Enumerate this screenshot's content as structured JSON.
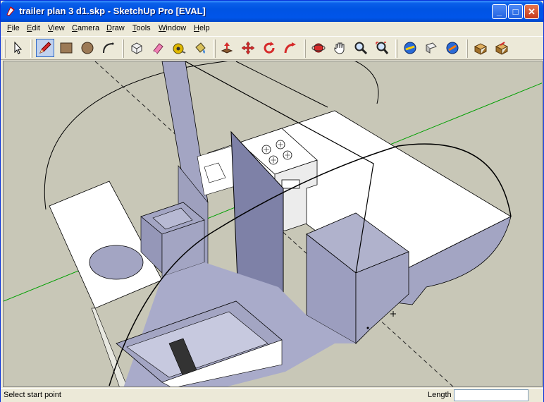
{
  "window": {
    "title": "trailer plan 3 d1.skp - SketchUp Pro [EVAL]",
    "minimize_glyph": "_",
    "maximize_glyph": "□",
    "close_glyph": "✕"
  },
  "menu": {
    "items": [
      {
        "first": "F",
        "rest": "ile"
      },
      {
        "first": "E",
        "rest": "dit"
      },
      {
        "first": "V",
        "rest": "iew"
      },
      {
        "first": "C",
        "rest": "amera"
      },
      {
        "first": "D",
        "rest": "raw"
      },
      {
        "first": "T",
        "rest": "ools"
      },
      {
        "first": "W",
        "rest": "indow"
      },
      {
        "first": "H",
        "rest": "elp"
      }
    ]
  },
  "toolbar": {
    "tools": [
      "select-tool-icon",
      "pencil-line-tool-icon",
      "rectangle-tool-icon",
      "circle-tool-icon",
      "arc-tool-icon",
      "make-component-icon",
      "eraser-tool-icon",
      "tape-measure-icon",
      "paint-bucket-icon",
      "push-pull-icon",
      "move-tool-icon",
      "rotate-tool-icon",
      "follow-me-icon",
      "orbit-icon",
      "pan-icon",
      "zoom-icon",
      "zoom-extents-icon",
      "get-models-icon",
      "share-model-icon",
      "share-component-icon",
      "get-components-icon",
      "extension-warehouse-icon"
    ],
    "active_tool": "pencil-line-tool-icon"
  },
  "status": {
    "message": "Select start point",
    "measure_label": "Length",
    "measure_value": ""
  },
  "colors": {
    "title_bar": "#0054e3",
    "viewport_bg": "#c8c7b7",
    "face_front": "#ffffff",
    "face_back": "#a3a5c3",
    "axis_green": "#00a000"
  }
}
